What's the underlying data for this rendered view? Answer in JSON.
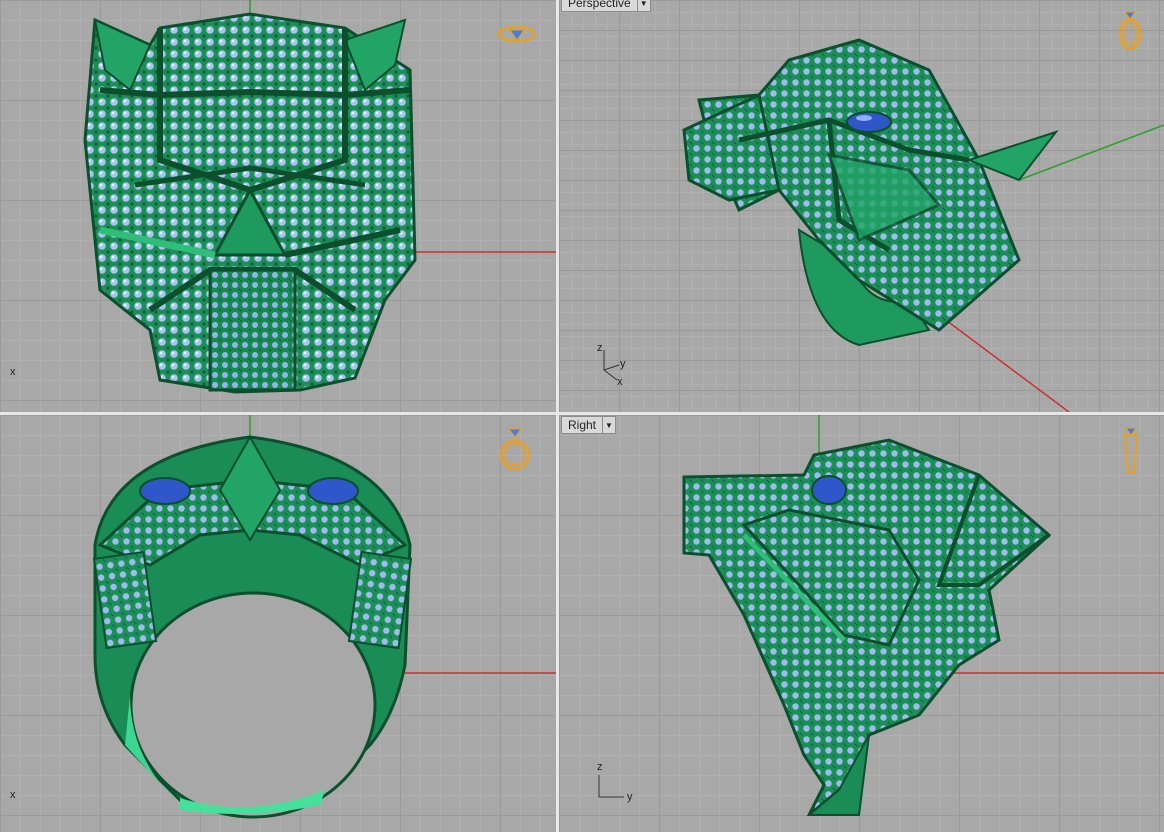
{
  "viewports": {
    "top_left": {
      "axis_x": "x"
    },
    "top_right": {
      "label": "Perspective",
      "axis_x": "x",
      "axis_y": "y",
      "axis_z": "z"
    },
    "bottom_left": {
      "axis_x": "x"
    },
    "bottom_right": {
      "label": "Right",
      "axis_y": "y",
      "axis_z": "z"
    }
  },
  "icons": {
    "top_left": "ring-top-view-icon",
    "top_right": "ring-perspective-icon",
    "bottom_left": "ring-front-view-icon",
    "bottom_right": "ring-side-view-icon"
  },
  "colors": {
    "model_green": "#1f9a5e",
    "model_dark": "#0d5a34",
    "gem_blue": "#8fb0e8",
    "eye_sapphire": "#2f57c9",
    "axis_red": "#c83232",
    "axis_green": "#2aa12a",
    "icon_orange": "#e8a020"
  }
}
